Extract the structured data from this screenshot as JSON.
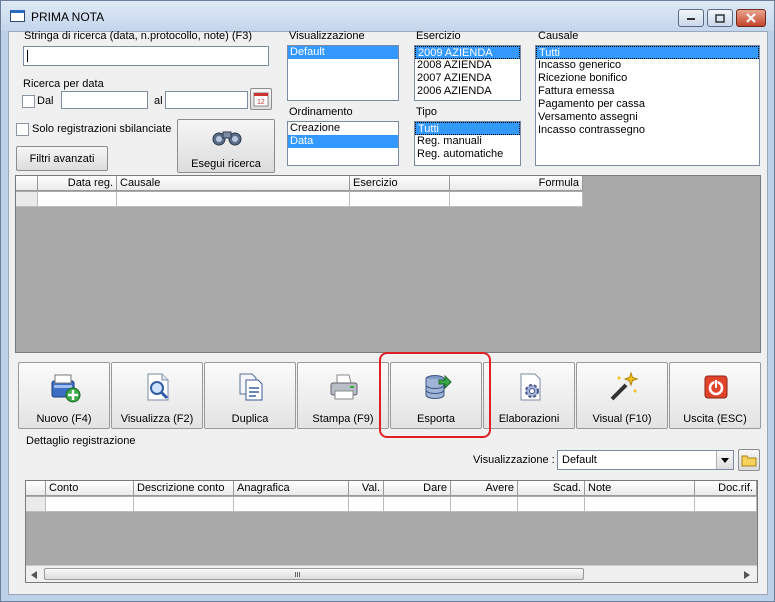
{
  "window": {
    "title": "PRIMA NOTA"
  },
  "search": {
    "label": "Stringa di ricerca (data, n.protocollo, note) (F3)",
    "value": "",
    "date_group_label": "Ricerca per data",
    "dal_label": "Dal",
    "al_label": "al",
    "dal_value": "",
    "al_value": "",
    "unbalanced_label": "Solo registrazioni sbilanciate",
    "advanced_filters_label": "Filtri avanzati",
    "execute_label": "Esegui ricerca"
  },
  "visualizzazione": {
    "label": "Visualizzazione",
    "items": [
      "Default"
    ],
    "selected_index": 0
  },
  "ordinamento": {
    "label": "Ordinamento",
    "items": [
      "Creazione",
      "Data"
    ],
    "selected_index": 1
  },
  "esercizio": {
    "label": "Esercizio",
    "items": [
      "2009 AZIENDA",
      "2008 AZIENDA",
      "2007 AZIENDA",
      "2006 AZIENDA"
    ],
    "selected_index": 0
  },
  "tipo": {
    "label": "Tipo",
    "items": [
      "Tutti",
      "Reg. manuali",
      "Reg. automatiche"
    ],
    "selected_index": 0
  },
  "causale": {
    "label": "Causale",
    "items": [
      "Tutti",
      "Incasso generico",
      "Ricezione bonifico",
      "Fattura emessa",
      "Pagamento per cassa",
      "Versamento assegni",
      "Incasso contrassegno"
    ],
    "selected_index": 0
  },
  "results_grid": {
    "columns": [
      "Data reg.",
      "Causale",
      "Esercizio",
      "Formula"
    ]
  },
  "toolbar": {
    "buttons": [
      {
        "label": "Nuovo (F4)",
        "icon": "new-record-icon"
      },
      {
        "label": "Visualizza (F2)",
        "icon": "view-document-icon"
      },
      {
        "label": "Duplica",
        "icon": "duplicate-icon"
      },
      {
        "label": "Stampa (F9)",
        "icon": "printer-icon"
      },
      {
        "label": "Esporta",
        "icon": "export-database-icon"
      },
      {
        "label": "Elaborazioni",
        "icon": "processing-gear-icon"
      },
      {
        "label": "Visual (F10)",
        "icon": "magic-wand-icon"
      },
      {
        "label": "Uscita (ESC)",
        "icon": "exit-power-icon"
      }
    ]
  },
  "detail": {
    "label": "Dettaglio registrazione",
    "view_label": "Visualizzazione :",
    "view_value": "Default",
    "columns": [
      "Conto",
      "Descrizione conto",
      "Anagrafica",
      "Val.",
      "Dare",
      "Avere",
      "Scad.",
      "Note",
      "Doc.rif."
    ]
  },
  "colors": {
    "selection": "#3399ff",
    "highlight_border": "#e01f24",
    "grid_background": "#a9a9a9"
  }
}
